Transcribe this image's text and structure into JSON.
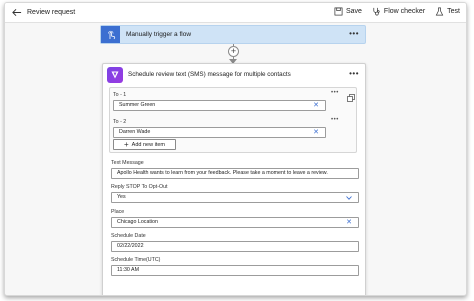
{
  "topbar": {
    "title": "Review request",
    "save_label": "Save",
    "flow_checker_label": "Flow checker",
    "test_label": "Test"
  },
  "trigger": {
    "label": "Manually trigger a flow"
  },
  "action": {
    "title": "Schedule review text (SMS) message for multiple contacts",
    "to_items": [
      {
        "label": "To - 1",
        "value": "Summer Green"
      },
      {
        "label": "To - 2",
        "value": "Darren Wade"
      }
    ],
    "add_new_item_label": "Add new item",
    "text_message": {
      "label": "Text Message",
      "value": "Apollo Health wants to learn from your feedback. Please take a moment to leave a review."
    },
    "reply_stop": {
      "label": "Reply STOP To Opt-Out",
      "value": "Yes"
    },
    "place": {
      "label": "Place",
      "value": "Chicago Location"
    },
    "schedule_date": {
      "label": "Schedule Date",
      "value": "02/22/2022"
    },
    "schedule_time": {
      "label": "Schedule Time(UTC)",
      "value": "11:30 AM"
    }
  },
  "colors": {
    "trigger_bg": "#cfe3f6",
    "trigger_icon": "#3c6fd1",
    "action_icon": "#7a44e6",
    "accent": "#3c6fd1"
  }
}
